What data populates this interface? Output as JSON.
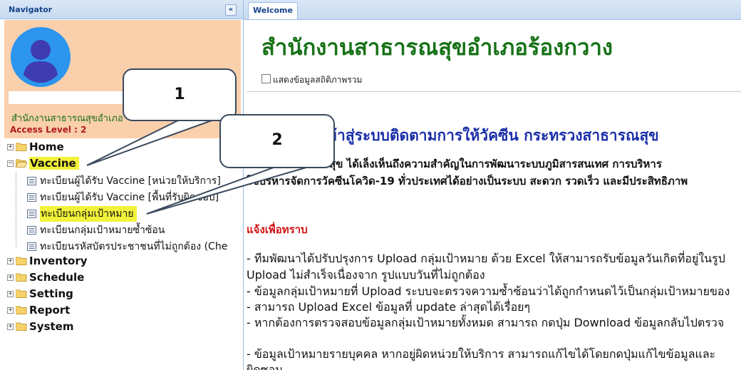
{
  "navigator": {
    "title": "Navigator",
    "collapse_icon": "«",
    "office_name": "สำนักงานสาธารณสุขอำเภอ",
    "access_level": "Access Level : 2"
  },
  "tree": {
    "expand_glyph": "+",
    "collapse_glyph": "−",
    "home": "Home",
    "vaccine": "Vaccine",
    "vaccine_items": [
      "ทะเบียนผู้ได้รับ Vaccine [หน่วยให้บริการ]",
      "ทะเบียนผู้ได้รับ Vaccine [พื้นที่รับผิดชอบ]",
      "ทะเบียนกลุ่มเป้าหมาย",
      "ทะเบียนกลุ่มเป้าหมายซ้ำซ้อน",
      "ทะเบียนรหัสบัตรประชาชนที่ไม่ถูกต้อง (Che"
    ],
    "inventory": "Inventory",
    "schedule": "Schedule",
    "setting": "Setting",
    "report": "Report",
    "system": "System"
  },
  "callouts": {
    "one": "1",
    "two": "2"
  },
  "tabs": {
    "welcome": "Welcome"
  },
  "main": {
    "office_title": "สำนักงานสาธารณสุขอำเภอร้องกวาง",
    "stats_label": "แสดงข้อมูลสถิติภาพรวม",
    "welcome_heading": "ยินดีต้อนรับเข้าสู่ระบบติดตามการให้วัคซีน กระทรวงสาธารณสุข",
    "intro_lines": [
      "กระทรวงสาธารณสุข ได้เล็งเห็นถึงความสำคัญในการพัฒนาระบบภูมิสารสนเทศ การบริหาร",
      "ใช้บริหารจัดการวัคซีนโควิด-19 ทั่วประเทศได้อย่างเป็นระบบ สะดวก รวดเร็ว และมีประสิทธิภาพ"
    ],
    "notice_heading": "แจ้งเพื่อทราบ",
    "bullets": [
      "- ทีมพัฒนาได้ปรับปรุงการ Upload กลุ่มเป้าหมาย ด้วย Excel ให้สามารถรับข้อมูลวันเกิดที่อยู่ในรูป",
      "Upload ไม่สำเร็จเนื่องจาก รูปแบบวันที่ไม่ถูกต้อง",
      "- ข้อมูลกลุ่มเป้าหมายที่ Upload ระบบจะตรวจความซ้ำซ้อนว่าได้ถูกกำหนดไว้เป็นกลุ่มเป้าหมายของ",
      "- สามารถ Upload Excel ข้อมูลที่ update ล่าสุดได้เรื่อยๆ",
      "- หากต้องการตรวจสอบข้อมูลกลุ่มเป้าหมายทั้งหมด สามารถ กดปุ่ม Download ข้อมูลกลับไปตรวจ",
      "- ข้อมูลเป้าหมายรายบุคคล หากอยู่ผิดหน่วยให้บริการ สามารถแก้ไขได้โดยกดปุ่มแก้ไขข้อมูลและ",
      "ผิดซอน"
    ]
  },
  "colors": {
    "profile_bg": "#f9cfac",
    "highlight": "#f2f23a",
    "office_title": "#177217",
    "heading_blue": "#1b2fa8",
    "notice_red": "#d11414",
    "avatar_circle": "#2c95ee",
    "avatar_figure": "#3f3bb0"
  },
  "icons": {
    "avatar": "user-avatar-icon",
    "folder": "folder-icon",
    "folder_open": "folder-open-icon",
    "doc": "document-list-icon",
    "collapse": "double-chevron-left-icon"
  }
}
